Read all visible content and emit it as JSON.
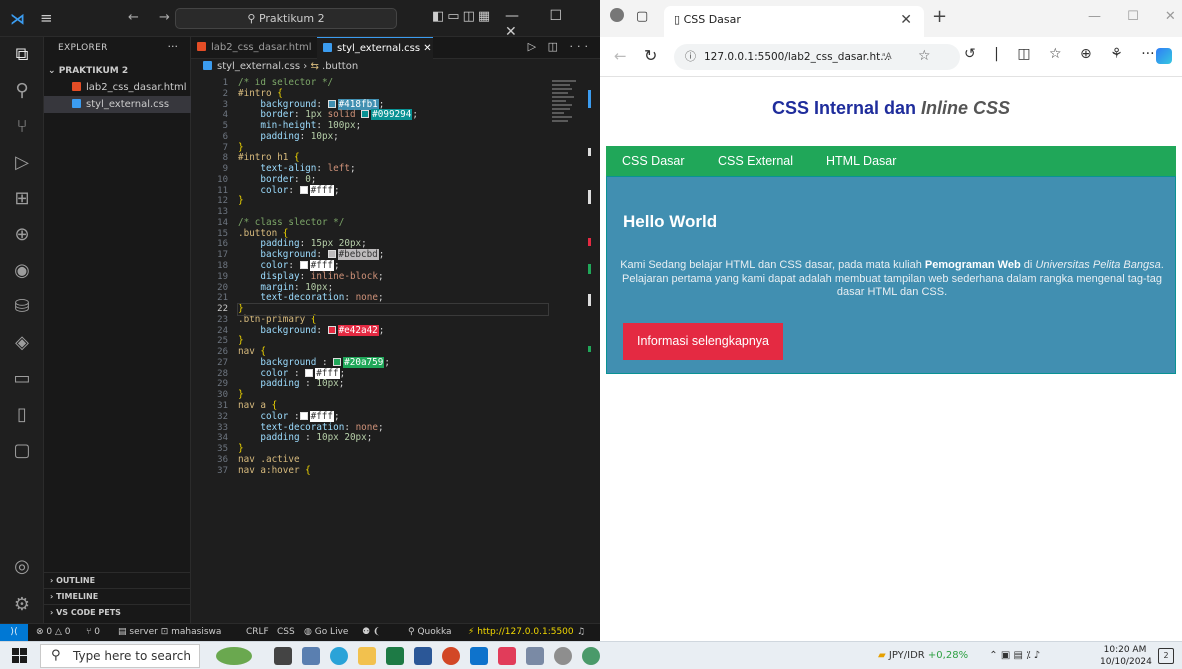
{
  "vscode": {
    "search": "Praktikum 2",
    "explorer": {
      "header": "EXPLORER",
      "folder": "PRAKTIKUM 2",
      "files": [
        "lab2_css_dasar.html",
        "styl_external.css"
      ],
      "sections": [
        "OUTLINE",
        "TIMELINE",
        "VS CODE PETS"
      ]
    },
    "tabs": [
      "lab2_css_dasar.html",
      "styl_external.css"
    ],
    "breadcrumb": {
      "file": "styl_external.css",
      "symbol": ".button"
    },
    "current_line": 22,
    "code": [
      [
        [
          "com",
          "/* id selector */"
        ]
      ],
      [
        [
          "sel",
          "#intro "
        ],
        [
          "br",
          "{"
        ]
      ],
      [
        [
          "",
          "    "
        ],
        [
          "prop",
          "background"
        ],
        [
          "",
          ": "
        ],
        [
          "sw",
          "#418fb1"
        ],
        [
          "",
          ";"
        ]
      ],
      [
        [
          "",
          "    "
        ],
        [
          "prop",
          "border"
        ],
        [
          "",
          ": "
        ],
        [
          "num",
          "1px"
        ],
        [
          "val",
          " solid "
        ],
        [
          "sw",
          "#099294"
        ],
        [
          "",
          ";"
        ]
      ],
      [
        [
          "",
          "    "
        ],
        [
          "prop",
          "min-height"
        ],
        [
          "",
          ": "
        ],
        [
          "num",
          "100px"
        ],
        [
          "",
          ";"
        ]
      ],
      [
        [
          "",
          "    "
        ],
        [
          "prop",
          "padding"
        ],
        [
          "",
          ": "
        ],
        [
          "num",
          "10px"
        ],
        [
          "",
          ";"
        ]
      ],
      [
        [
          "br",
          "}"
        ]
      ],
      [
        [
          "sel",
          "#intro h1 "
        ],
        [
          "br",
          "{"
        ]
      ],
      [
        [
          "",
          "    "
        ],
        [
          "prop",
          "text-align"
        ],
        [
          "",
          ": "
        ],
        [
          "val",
          "left"
        ],
        [
          "",
          ";"
        ]
      ],
      [
        [
          "",
          "    "
        ],
        [
          "prop",
          "border"
        ],
        [
          "",
          ": "
        ],
        [
          "num",
          "0"
        ],
        [
          "",
          ";"
        ]
      ],
      [
        [
          "",
          "    "
        ],
        [
          "prop",
          "color"
        ],
        [
          "",
          ": "
        ],
        [
          "sw",
          "#fff"
        ],
        [
          "",
          ";"
        ]
      ],
      [
        [
          "br",
          "}"
        ]
      ],
      [
        [
          "",
          ""
        ]
      ],
      [
        [
          "com",
          "/* class slector */"
        ]
      ],
      [
        [
          "sel",
          ".button "
        ],
        [
          "br",
          "{"
        ]
      ],
      [
        [
          "",
          "    "
        ],
        [
          "prop",
          "padding"
        ],
        [
          "",
          ": "
        ],
        [
          "num",
          "15px 20px"
        ],
        [
          "",
          ";"
        ]
      ],
      [
        [
          "",
          "    "
        ],
        [
          "prop",
          "background"
        ],
        [
          "",
          ": "
        ],
        [
          "sw",
          "#bebcbd"
        ],
        [
          "",
          ";"
        ]
      ],
      [
        [
          "",
          "    "
        ],
        [
          "prop",
          "color"
        ],
        [
          "",
          ": "
        ],
        [
          "sw",
          "#fff"
        ],
        [
          "",
          ";"
        ]
      ],
      [
        [
          "",
          "    "
        ],
        [
          "prop",
          "display"
        ],
        [
          "",
          ": "
        ],
        [
          "val",
          "inline-block"
        ],
        [
          "",
          ";"
        ]
      ],
      [
        [
          "",
          "    "
        ],
        [
          "prop",
          "margin"
        ],
        [
          "",
          ": "
        ],
        [
          "num",
          "10px"
        ],
        [
          "",
          ";"
        ]
      ],
      [
        [
          "",
          "    "
        ],
        [
          "prop",
          "text-decoration"
        ],
        [
          "",
          ": "
        ],
        [
          "val",
          "none"
        ],
        [
          "",
          ";"
        ]
      ],
      [
        [
          "br",
          "}"
        ]
      ],
      [
        [
          "sel",
          ".btn-primary "
        ],
        [
          "br",
          "{"
        ]
      ],
      [
        [
          "",
          "    "
        ],
        [
          "prop",
          "background"
        ],
        [
          "",
          ": "
        ],
        [
          "sw",
          "#e42a42"
        ],
        [
          "",
          ";"
        ]
      ],
      [
        [
          "br",
          "}"
        ]
      ],
      [
        [
          "sel",
          "nav "
        ],
        [
          "br",
          "{"
        ]
      ],
      [
        [
          "",
          "    "
        ],
        [
          "prop",
          "background "
        ],
        [
          "",
          ": "
        ],
        [
          "sw",
          "#20a759"
        ],
        [
          "",
          ";"
        ]
      ],
      [
        [
          "",
          "    "
        ],
        [
          "prop",
          "color "
        ],
        [
          "",
          ": "
        ],
        [
          "sw",
          "#fff"
        ],
        [
          "",
          ";"
        ]
      ],
      [
        [
          "",
          "    "
        ],
        [
          "prop",
          "padding "
        ],
        [
          "",
          ": "
        ],
        [
          "num",
          "10px"
        ],
        [
          "",
          ";"
        ]
      ],
      [
        [
          "br",
          "}"
        ]
      ],
      [
        [
          "sel",
          "nav a "
        ],
        [
          "br",
          "{"
        ]
      ],
      [
        [
          "",
          "    "
        ],
        [
          "prop",
          "color "
        ],
        [
          "",
          ":"
        ],
        [
          "sw",
          "#fff"
        ],
        [
          "",
          ";"
        ]
      ],
      [
        [
          "",
          "    "
        ],
        [
          "prop",
          "text-decoration"
        ],
        [
          "",
          ": "
        ],
        [
          "val",
          "none"
        ],
        [
          "",
          ";"
        ]
      ],
      [
        [
          "",
          "    "
        ],
        [
          "prop",
          "padding "
        ],
        [
          "",
          ": "
        ],
        [
          "num",
          "10px 20px"
        ],
        [
          "",
          ";"
        ]
      ],
      [
        [
          "br",
          "}"
        ]
      ],
      [
        [
          "sel",
          "nav .active"
        ]
      ],
      [
        [
          "sel",
          "nav a:hover "
        ],
        [
          "br",
          "{"
        ]
      ]
    ],
    "status": {
      "problems": "⊗ 0 △ 0",
      "ports": "⑂ 0",
      "server": "server",
      "user": "mahasiswa",
      "eol": "CRLF",
      "language": "CSS",
      "golive": "Go Live",
      "quokka": "Quokka",
      "live_url": "http://127.0.0.1:5500"
    }
  },
  "browser": {
    "tab_title": "CSS Dasar",
    "url": "127.0.0.1:5500/lab2_css_dasar.ht...",
    "page": {
      "heading_main": "CSS Internal dan ",
      "heading_italic": "Inline CSS",
      "nav": [
        "CSS Dasar",
        "CSS External",
        "HTML Dasar"
      ],
      "intro_title": "Hello World",
      "intro_p1": "Kami Sedang belajar HTML dan CSS dasar, pada mata kuliah ",
      "intro_bold": "Pemograman Web",
      "intro_p2": " di ",
      "intro_italic": "Universitas Pelita Bangsa",
      "intro_p3": ". Pelajaran pertama yang kami dapat adalah membuat tampilan web sederhana dalam rangka mengenal tag-tag dasar HTML dan CSS.",
      "button": "Informasi selengkapnya"
    },
    "colors": {
      "heading": "#1f2d9c",
      "nav": "#20a759",
      "intro": "#418fb1",
      "button": "#e42a42"
    }
  },
  "taskbar": {
    "search_placeholder": "Type here to search",
    "ticker_label": "JPY/IDR",
    "ticker_change": "+0,28%",
    "time": "10:20 AM",
    "date": "10/10/2024",
    "notifications": "2"
  }
}
